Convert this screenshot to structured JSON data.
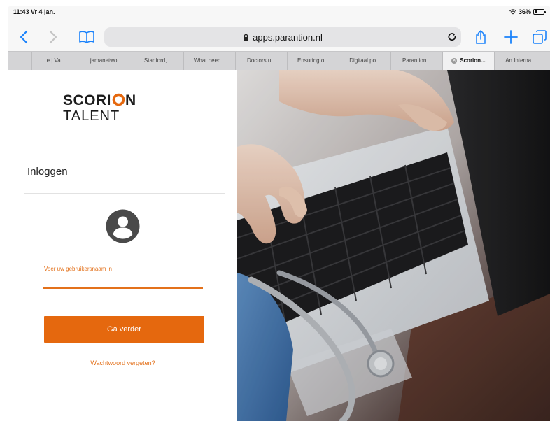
{
  "status_bar": {
    "time": "11:43  Vr 4 jan.",
    "battery": "36%",
    "battery_level": 0.36
  },
  "toolbar": {
    "url": "apps.parantion.nl",
    "back_icon": "chevron-left-icon",
    "forward_icon": "chevron-right-icon",
    "bookmarks_icon": "book-icon",
    "lock_icon": "lock-icon",
    "reload_icon": "reload-icon",
    "share_icon": "share-icon",
    "new_tab_icon": "plus-icon",
    "tabs_icon": "tabs-icon",
    "accent_color": "#1a82fb"
  },
  "tabs": [
    {
      "label": "...",
      "active": false
    },
    {
      "label": "e | Va...",
      "active": false
    },
    {
      "label": "jamanetwo...",
      "active": false
    },
    {
      "label": "Stanford,...",
      "active": false
    },
    {
      "label": "What need...",
      "active": false
    },
    {
      "label": "Doctors u...",
      "active": false
    },
    {
      "label": "Ensuring o...",
      "active": false
    },
    {
      "label": "Digitaal po...",
      "active": false
    },
    {
      "label": "Parantion...",
      "active": false
    },
    {
      "label": "Scorion...",
      "active": true
    },
    {
      "label": "An Interna...",
      "active": false
    }
  ],
  "login": {
    "logo_line1_a": "SCORI",
    "logo_line1_b": "N",
    "logo_line2": "TALENT",
    "title": "Inloggen",
    "username_label": "Voer uw gebruikersnaam in",
    "username_value": "",
    "continue_label": "Ga verder",
    "forgot_label": "Wachtwoord vergeten?",
    "brand_color": "#e5680e"
  }
}
